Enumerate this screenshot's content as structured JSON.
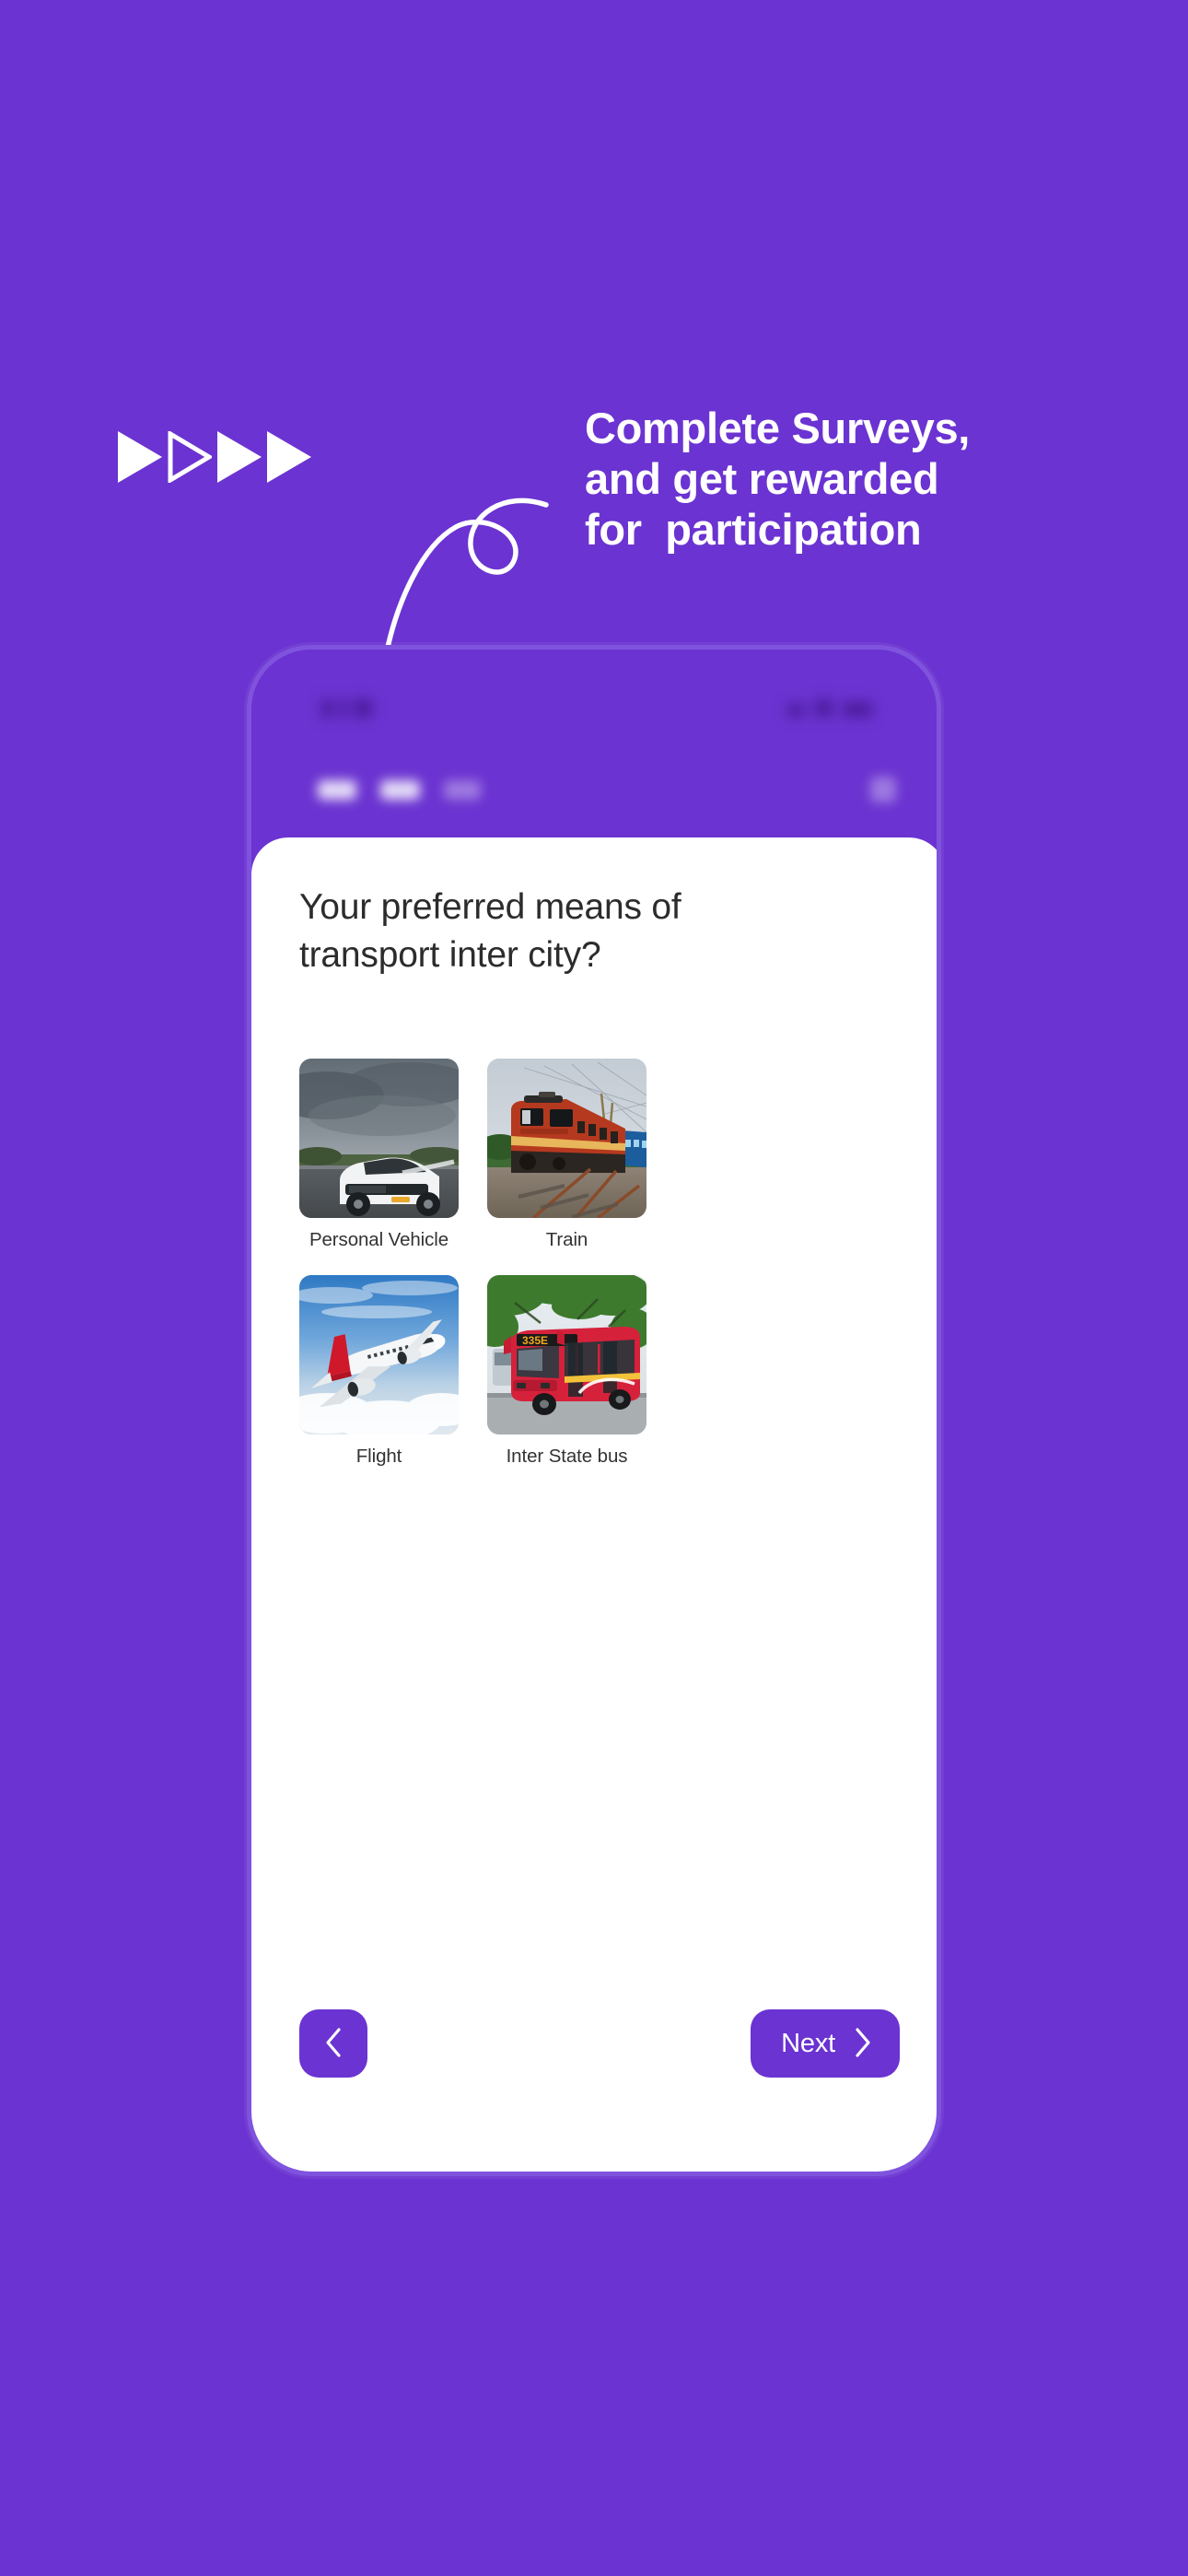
{
  "theme": {
    "background": "#6B33D1",
    "accent": "#6B33D1",
    "card_bg": "#FFFFFF",
    "headline_color": "#FFFFFF",
    "question_color": "#2C2C2C",
    "label_color": "#333333",
    "phone_frame": "#7F53DE"
  },
  "decor": {
    "triangles": [
      "filled",
      "outline",
      "filled",
      "filled"
    ],
    "arrow": "curved-loop-arrow-down"
  },
  "headline": {
    "line1": "Complete Surveys,",
    "line2": "and get rewarded",
    "line3": "for  participation"
  },
  "phone": {
    "status_bar": {
      "blurred": true
    },
    "app_header": {
      "blurred": true,
      "tabs": 3,
      "action_icon": "menu-icon"
    }
  },
  "survey": {
    "question": "Your preferred means of transport inter city?",
    "options": [
      {
        "label": "Personal Vehicle",
        "image": "white-suv-on-highway-under-grey-clouds"
      },
      {
        "label": "Train",
        "image": "indian-railways-wap4-locomotive-22820-on-tracks"
      },
      {
        "label": "Flight",
        "image": "white-airliner-with-red-tail-in-blue-sky"
      },
      {
        "label": "Inter State bus",
        "image": "red-city-bus-route-335E-under-trees"
      }
    ],
    "footer": {
      "back_label": "",
      "back_icon": "chevron-left-icon",
      "next_label": "Next",
      "next_icon": "chevron-right-icon"
    }
  }
}
